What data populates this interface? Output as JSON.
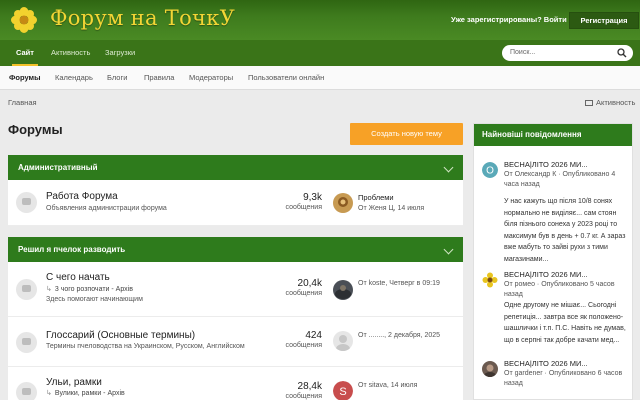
{
  "header": {
    "site_title": "Форум на ТочкУ",
    "account_label": "Уже зарегистрированы? Войти",
    "register_label": "Регистрация"
  },
  "nav": {
    "tabs": [
      "Сайт",
      "Активность",
      "Загрузки"
    ],
    "search_placeholder": "Поиск..."
  },
  "subnav": {
    "tabs": [
      "Форумы",
      "Календарь",
      "Блоги",
      "Правила",
      "Модераторы",
      "Пользователи онлайн"
    ]
  },
  "breadcrumb": "Главная",
  "activity_link": "Активность",
  "page_title": "Форумы",
  "new_topic_label": "Создать новую тему",
  "categories": [
    {
      "title": "Административный",
      "forums": [
        {
          "title": "Работа Форума",
          "desc": "Объявления администрации форума",
          "count": "9,3k",
          "count_label": "сообщения",
          "last_title": "Проблеми",
          "last_meta": "От Женя Ц, 14 июля"
        }
      ]
    },
    {
      "title": "Решил я пчелок разводить",
      "forums": [
        {
          "title": "С чего начать",
          "sub": "3 чого розпочати - Архів",
          "desc": "Здесь помогают начинающим",
          "count": "20,4k",
          "count_label": "сообщения",
          "last_meta": "От koste, Четверг в 09:19"
        },
        {
          "title": "Глоссарий (Основные термины)",
          "desc": "Термины пчеловодства на Украинском, Русском, Английском",
          "count": "424",
          "count_label": "сообщения",
          "last_meta": "От ........, 2 декабря, 2025"
        },
        {
          "title": "Ульи, рамки",
          "sub": "Вулики, рамки - Архів",
          "count": "28,4k",
          "count_label": "сообщения",
          "last_meta": "От sitava, 14 июля"
        }
      ]
    }
  ],
  "sidebar": {
    "title": "Найновіші повідомлення",
    "items": [
      {
        "avatar_letter": "O",
        "title": "ВЕСНА|ЛІТО 2026 МИ...",
        "meta": "От Олександр К · Опубликовано 4 часа назад",
        "body": "У нас кажуть що після 10/8 сонях нормально не виділяє... сам стоян біля пізнього сонеха у 2023 році то максимум був в день + 0.7 кг. А зараз вже мабуть то зайві рухи з тими магазинами..."
      },
      {
        "title": "ВЕСНА|ЛІТО 2026 МИ...",
        "meta": "От ромео · Опубликовано 5 часов назад",
        "body": "Одне другому не мішає... Сьогодні репетиція... завтра все як положено-шашлички і т.п. П.С. Навіть не думав, що в серпні так добре качати мед..."
      },
      {
        "title": "ВЕСНА|ЛІТО 2026 МИ...",
        "meta": "От gardener · Опубликовано 6 часов назад",
        "body": ""
      }
    ]
  },
  "colors": {
    "header_green": "#3e7b1d",
    "nav_green": "#3a7418",
    "category_green": "#2e7b1c",
    "title_yellow": "#f3d535",
    "button_orange": "#f7a126",
    "active_tab_underline": "#f4c12a"
  }
}
